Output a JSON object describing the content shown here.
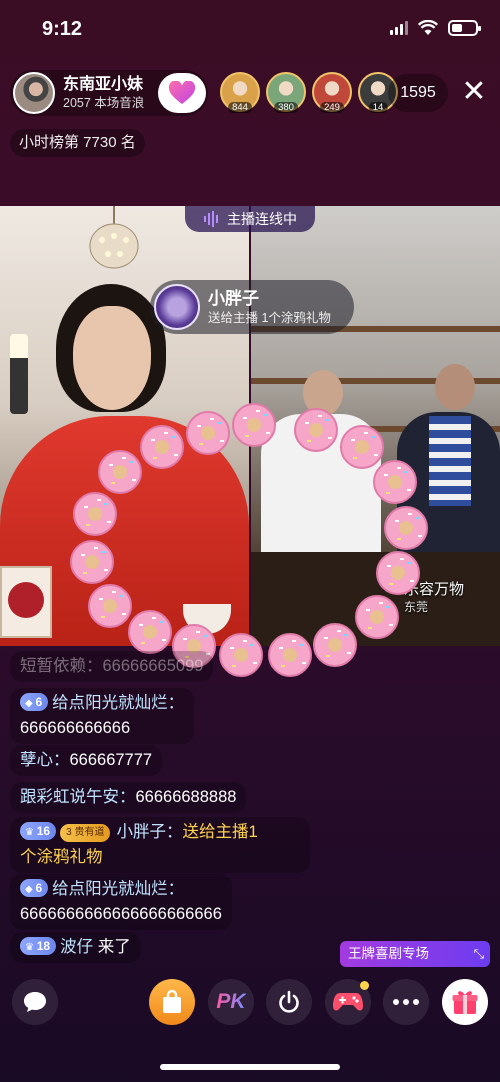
{
  "status_bar": {
    "time": "9:12",
    "battery_level": 0.45
  },
  "header": {
    "host_name": "东南亚小妹",
    "host_subtitle": "2057 本场音浪",
    "viewer_count": "1595",
    "rank_text": "小时榜第 7730 名",
    "viewers": [
      {
        "value": "844",
        "color": "#d9a24a"
      },
      {
        "value": "380",
        "color": "#7aa67a"
      },
      {
        "value": "249",
        "color": "#c0483a"
      },
      {
        "value": "14",
        "color": "#3c3c3c"
      }
    ]
  },
  "video": {
    "mic_link_label": "主播连线中",
    "gift_user": "小胖子",
    "gift_desc": "送给主播 1个涂鸦礼物",
    "guest_name": "乐容万物",
    "guest_city": "东莞"
  },
  "chat": {
    "msg1": {
      "user": "短暂依赖",
      "text": "66666665099"
    },
    "msg2": {
      "level": "6",
      "user": "给点阳光就灿烂",
      "text": "666666666666"
    },
    "msg3": {
      "user": "孽心",
      "text": "666667777"
    },
    "msg4": {
      "user": "跟彩虹说午安",
      "text": "66666688888"
    },
    "msg5": {
      "level": "16",
      "noble_level": "3",
      "noble": "贵有道",
      "user": "小胖子",
      "text_line1": "送给主播1",
      "text_line2": "个涂鸦礼物"
    },
    "msg6": {
      "level": "6",
      "user": "给点阳光就灿烂",
      "text": "6666666666666666666666"
    },
    "msg7": {
      "level": "18",
      "user": "波仔",
      "text": "来了"
    }
  },
  "promo_badge": "王牌喜剧专场",
  "toolbar": {
    "comment_icon": "chat-bubble-icon",
    "shop_icon": "shopping-bag-icon",
    "pk_label": "PK",
    "power_icon": "power-icon",
    "game_icon": "gamepad-icon",
    "more_icon": "more-icon",
    "gift_icon": "gift-box-icon"
  },
  "colors": {
    "background_top": "#3b0d24",
    "background_bottom": "#190a25",
    "chat_user": "#c2e4ff",
    "gold": "#ffd44d",
    "donut": "#f6a6c9",
    "promo": "#8f3cf0"
  }
}
